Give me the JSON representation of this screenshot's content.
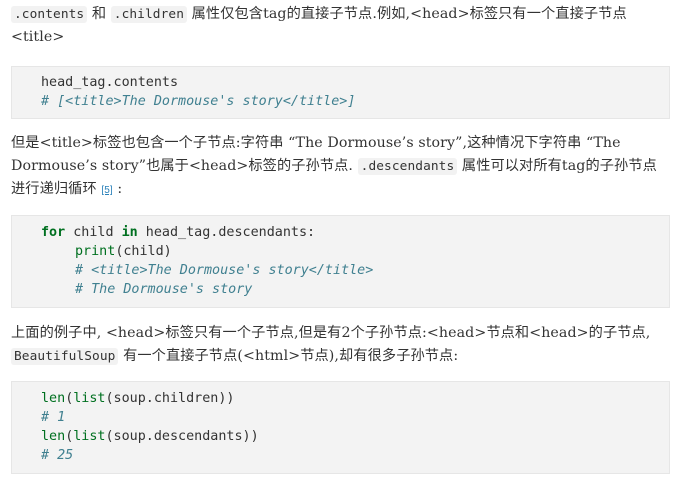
{
  "para1": {
    "code_contents": ".contents",
    "text_and": " 和 ",
    "code_children": ".children",
    "text_rest": " 属性仅包含tag的直接子节点.例如,<head>标签只有一个直接子节点<title>"
  },
  "code1": {
    "line1": "head_tag.contents",
    "line2": "# [<title>The Dormouse's story</title>]"
  },
  "para2": {
    "text_a": "但是<title>标签也包含一个子节点:字符串 “The Dormouse’s story”,这种情况下字符串 “The Dormouse’s story”也属于<head>标签的子孙节点. ",
    "code_descendants": ".descendants",
    "text_b": " 属性可以对所有tag的子孙节点进行递归循环 ",
    "footnote": "[5]",
    "text_c": " :"
  },
  "code2": {
    "kw_for": "for",
    "var_child": " child ",
    "kw_in": "in",
    "expr": " head_tag.descendants:",
    "fn_print": "print",
    "print_args": "(child)",
    "comment1": "# <title>The Dormouse's story</title>",
    "comment2": "# The Dormouse's story"
  },
  "para3": {
    "text_a": "上面的例子中, <head>标签只有一个子节点,但是有2个子孙节点:<head>节点和<head>的子节点, ",
    "code_bs": "BeautifulSoup",
    "text_b": " 有一个直接子节点(<html>节点),却有很多子孙节点:"
  },
  "code3": {
    "len1": "len",
    "list1": "list",
    "args1": "(soup.children))",
    "comment1": "# 1",
    "len2": "len",
    "list2": "list",
    "args2": "(soup.descendants))",
    "comment2": "# 25"
  }
}
